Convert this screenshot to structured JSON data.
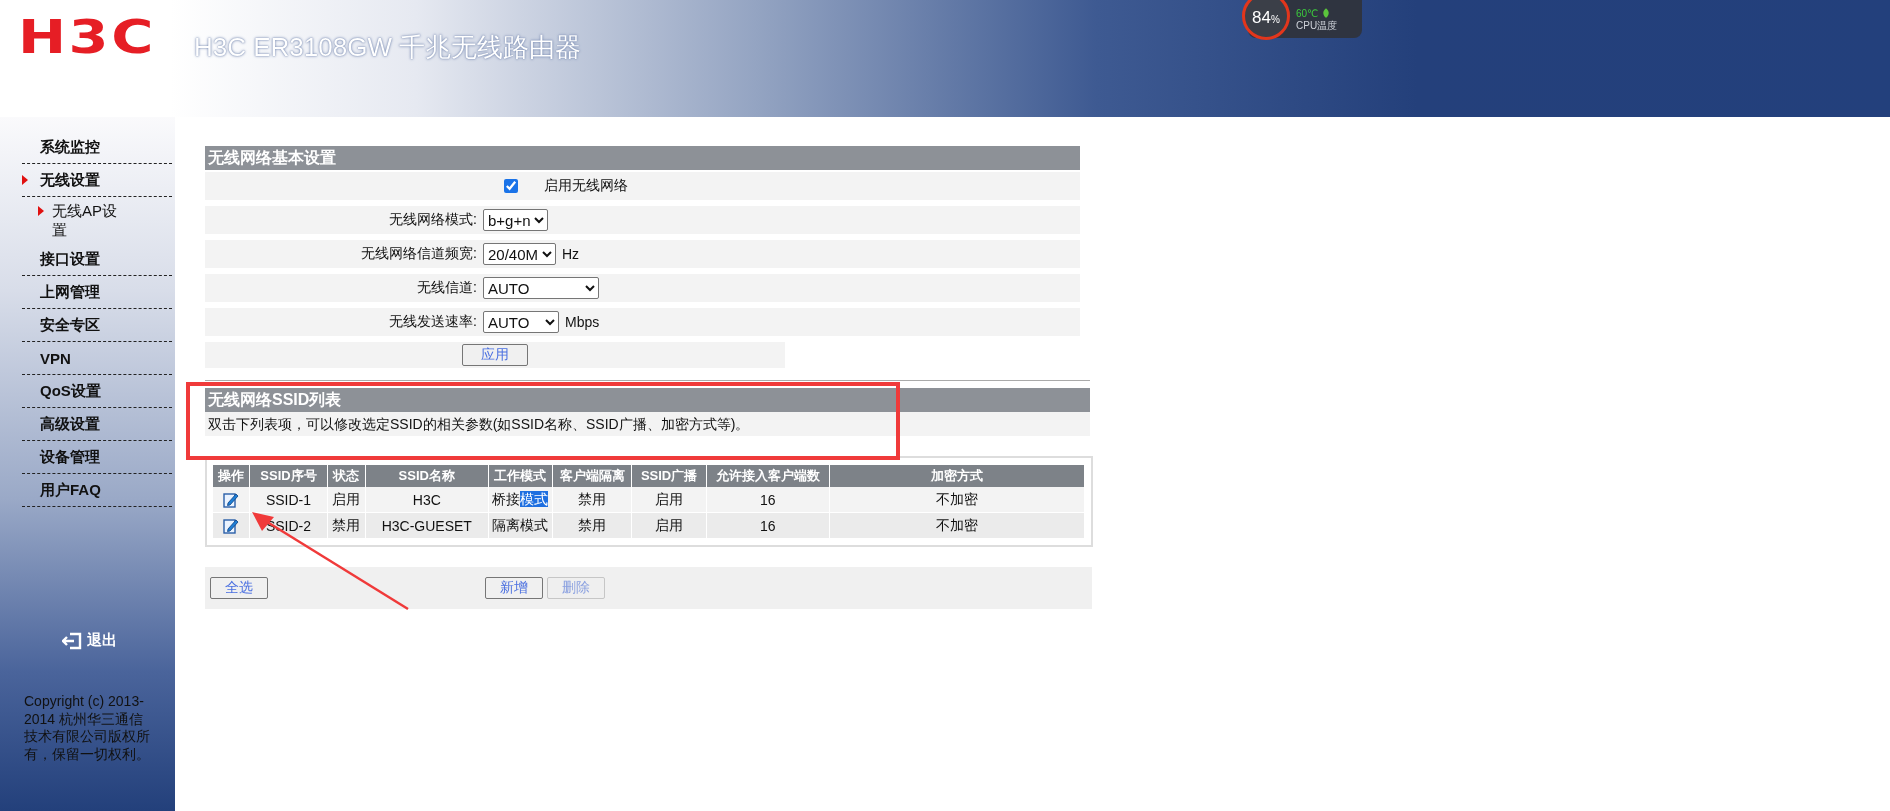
{
  "header": {
    "logo": "H3C",
    "title": "H3C ER3108GW 千兆无线路由器"
  },
  "cpu_widget": {
    "percent": "84",
    "unit": "%",
    "temperature": "60℃",
    "label": "CPU温度"
  },
  "sidebar": {
    "items": [
      {
        "label": "系统监控",
        "selected": false
      },
      {
        "label": "无线设置",
        "selected": true,
        "children": [
          {
            "label": "无线AP设置",
            "selected": true
          }
        ]
      },
      {
        "label": "接口设置",
        "selected": false
      },
      {
        "label": "上网管理",
        "selected": false
      },
      {
        "label": "安全专区",
        "selected": false
      },
      {
        "label": "VPN",
        "selected": false
      },
      {
        "label": "QoS设置",
        "selected": false
      },
      {
        "label": "高级设置",
        "selected": false
      },
      {
        "label": "设备管理",
        "selected": false
      },
      {
        "label": "用户FAQ",
        "selected": false
      }
    ],
    "logout": "退出",
    "copyright": "Copyright (c) 2013-2014  杭州华三通信技术有限公司版权所有，保留一切权利。"
  },
  "basic_settings": {
    "title": "无线网络基本设置",
    "enable": {
      "label": "启用无线网络",
      "checked": true
    },
    "fields": [
      {
        "label": "无线网络模式:",
        "value": "b+g+n"
      },
      {
        "label": "无线网络信道频宽:",
        "value": "20/40M",
        "unit": "Hz"
      },
      {
        "label": "无线信道:",
        "value": "AUTO"
      },
      {
        "label": "无线发送速率:",
        "value": "AUTO",
        "unit": "Mbps"
      }
    ],
    "apply_button": "应用"
  },
  "ssid_list": {
    "title": "无线网络SSID列表",
    "hint": "双击下列表项，可以修改选定SSID的相关参数(如SSID名称、SSID广播、加密方式等)。",
    "columns": [
      "操作",
      "SSID序号",
      "状态",
      "SSID名称",
      "工作模式",
      "客户端隔离",
      "SSID广播",
      "允许接入客户端数",
      "加密方式"
    ],
    "rows": [
      {
        "ssid": "SSID-1",
        "status": "启用",
        "name": "H3C",
        "work_mode": [
          {
            "text": "桥接",
            "highlighted": false
          },
          {
            "text": "模式",
            "highlighted": true
          }
        ],
        "isolation": "禁用",
        "broadcast": "启用",
        "max_clients": "16",
        "encryption": "不加密"
      },
      {
        "ssid": "SSID-2",
        "status": "禁用",
        "name": "H3C-GUESET",
        "work_mode": [
          {
            "text": "隔离模式",
            "highlighted": false
          }
        ],
        "isolation": "禁用",
        "broadcast": "启用",
        "max_clients": "16",
        "encryption": "不加密"
      }
    ],
    "buttons": [
      {
        "label": "全选",
        "disabled": false
      },
      {
        "label": "新增",
        "disabled": false
      },
      {
        "label": "删除",
        "disabled": true
      }
    ]
  }
}
